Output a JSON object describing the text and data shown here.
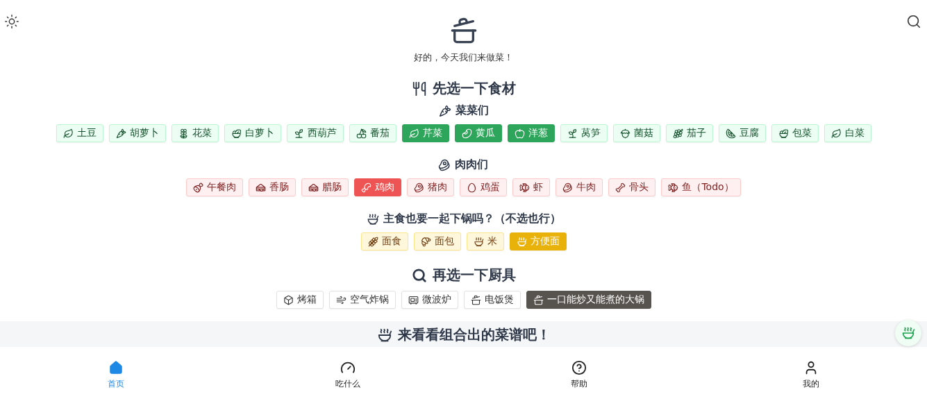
{
  "header": {
    "greeting": "好的，今天我们来做菜！"
  },
  "ingredients": {
    "title": "先选一下食材",
    "groups": [
      {
        "kind": "vegetable",
        "title": "菜菜们",
        "items": [
          {
            "label": "土豆",
            "selected": false
          },
          {
            "label": "胡萝卜",
            "selected": false
          },
          {
            "label": "花菜",
            "selected": false
          },
          {
            "label": "白萝卜",
            "selected": false
          },
          {
            "label": "西葫芦",
            "selected": false
          },
          {
            "label": "番茄",
            "selected": false
          },
          {
            "label": "芹菜",
            "selected": true
          },
          {
            "label": "黄瓜",
            "selected": true
          },
          {
            "label": "洋葱",
            "selected": true
          },
          {
            "label": "莴笋",
            "selected": false
          },
          {
            "label": "菌菇",
            "selected": false
          },
          {
            "label": "茄子",
            "selected": false
          },
          {
            "label": "豆腐",
            "selected": false
          },
          {
            "label": "包菜",
            "selected": false
          },
          {
            "label": "白菜",
            "selected": false
          }
        ]
      },
      {
        "kind": "meat",
        "title": "肉肉们",
        "items": [
          {
            "label": "午餐肉",
            "selected": false
          },
          {
            "label": "香肠",
            "selected": false
          },
          {
            "label": "腊肠",
            "selected": false
          },
          {
            "label": "鸡肉",
            "selected": true
          },
          {
            "label": "猪肉",
            "selected": false
          },
          {
            "label": "鸡蛋",
            "selected": false
          },
          {
            "label": "虾",
            "selected": false
          },
          {
            "label": "牛肉",
            "selected": false
          },
          {
            "label": "骨头",
            "selected": false
          },
          {
            "label": "鱼（Todo）",
            "selected": false
          }
        ]
      },
      {
        "kind": "staple",
        "title": "主食也要一起下锅吗？（不选也行）",
        "items": [
          {
            "label": "面食",
            "selected": false
          },
          {
            "label": "面包",
            "selected": false
          },
          {
            "label": "米",
            "selected": false
          },
          {
            "label": "方便面",
            "selected": true
          }
        ]
      }
    ]
  },
  "tools": {
    "title": "再选一下厨具",
    "items": [
      {
        "label": "烤箱",
        "selected": false
      },
      {
        "label": "空气炸锅",
        "selected": false
      },
      {
        "label": "微波炉",
        "selected": false
      },
      {
        "label": "电饭煲",
        "selected": false
      },
      {
        "label": "一口能炒又能煮的大锅",
        "selected": true
      }
    ]
  },
  "result": {
    "title": "来看看组合出的菜谱吧！"
  },
  "nav": [
    {
      "label": "首页",
      "selected": true
    },
    {
      "label": "吃什么",
      "selected": false
    },
    {
      "label": "帮助",
      "selected": false
    },
    {
      "label": "我的",
      "selected": false
    }
  ]
}
